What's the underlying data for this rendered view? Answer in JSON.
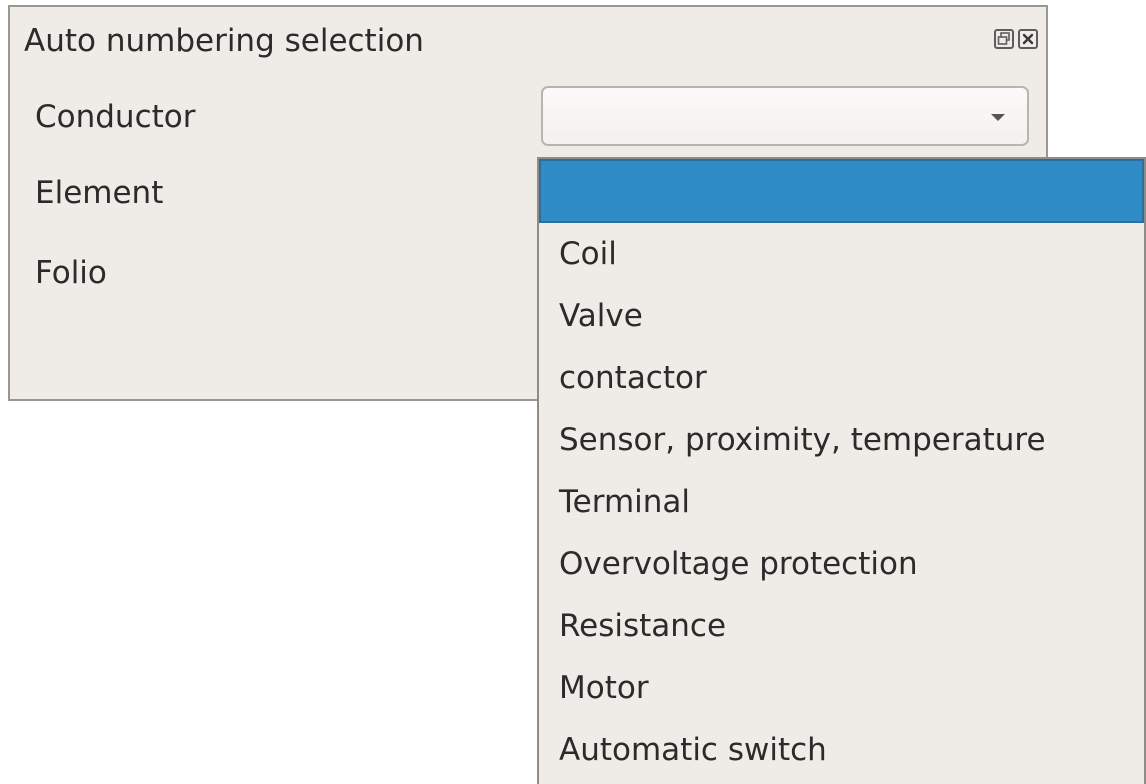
{
  "window": {
    "title": "Auto numbering selection",
    "buttons": {
      "float_icon": "float-icon",
      "close_icon": "close-icon"
    }
  },
  "form": {
    "labels": [
      "Conductor",
      "Element",
      "Folio"
    ],
    "conductor_combo": {
      "value": "",
      "arrow_icon": "chevron-down-icon"
    }
  },
  "dropdown": {
    "selected_index": 0,
    "options": [
      "",
      "Coil",
      "Valve",
      "contactor",
      "Sensor, proximity, temperature",
      "Terminal",
      "Overvoltage protection",
      "Resistance",
      "Motor",
      "Automatic switch"
    ]
  },
  "colors": {
    "background": "#efebe7",
    "selection": "#308cc6",
    "text": "#2b2b2b"
  }
}
